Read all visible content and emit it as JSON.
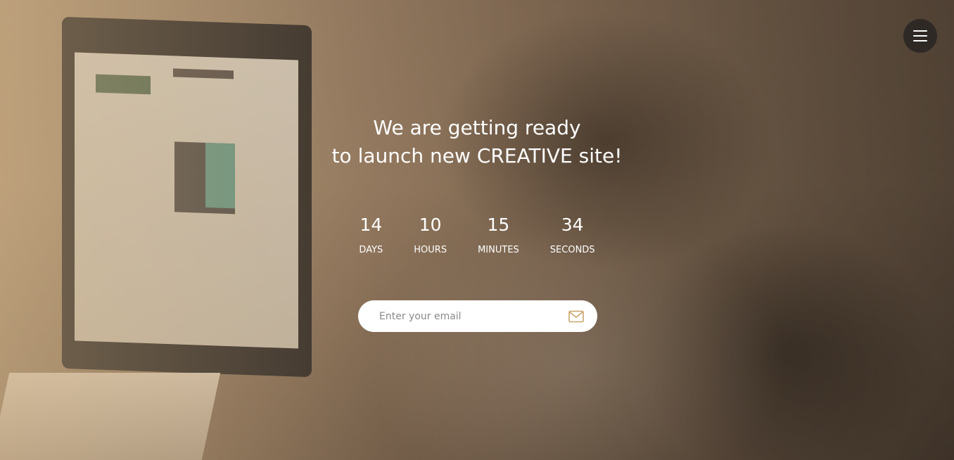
{
  "heading": {
    "line1": "We are getting ready",
    "line2": "to launch new CREATIVE site!"
  },
  "countdown": [
    {
      "value": "14",
      "label": "DAYS"
    },
    {
      "value": "10",
      "label": "HOURS"
    },
    {
      "value": "15",
      "label": "MINUTES"
    },
    {
      "value": "34",
      "label": "SECONDS"
    }
  ],
  "subscribe": {
    "placeholder": "Enter your email",
    "value": "",
    "submit_icon": "envelope-icon"
  },
  "menu": {
    "icon": "hamburger-menu-icon"
  },
  "colors": {
    "accent": "#c9a46a",
    "text": "#ffffff",
    "input_bg": "#ffffff",
    "menu_bg": "#2e2924"
  }
}
